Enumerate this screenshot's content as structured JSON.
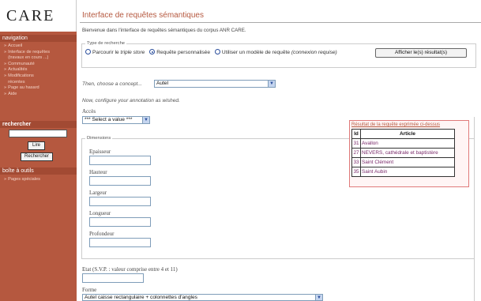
{
  "sidebar": {
    "logo": "CARE",
    "nav_heading": "navigation",
    "nav_items": [
      {
        "label": "Accueil"
      },
      {
        "label": "Interface de requêtes"
      },
      {
        "label": "(travaux en cours ...)"
      },
      {
        "label": "Communauté"
      },
      {
        "label": "Actualités"
      },
      {
        "label": "Modifications"
      },
      {
        "label": "récentes"
      },
      {
        "label": "Page au hasard"
      },
      {
        "label": "Aide"
      }
    ],
    "search_heading": "rechercher",
    "go_button": "Lire",
    "search_button": "Rechercher",
    "toolbox_heading": "boîte à outils",
    "toolbox_items": [
      {
        "label": "Pages spéciales"
      }
    ]
  },
  "main": {
    "title": "Interface de requêtes sémantiques",
    "welcome": "Bienvenue dans l'interface de requêtes sémantiques du corpus ANR CARE.",
    "search_type": {
      "legend": "Type de recherche",
      "opt1_pre": "Parcourir le ",
      "opt1_em": "triple store",
      "opt2": "Requête personnalisée",
      "opt3_pre": "Utiliser un modèle de requête ",
      "opt3_em": "(connexion requise)",
      "selected": "Requête personnalisée",
      "button": "Afficher le(s) résultat(s)"
    },
    "concept_prompt": "Then, choose a concept...",
    "concept_value": "Autel",
    "configure_prompt": "Now, configure your annotation as wished.",
    "acces_label": "Accès",
    "acces_value": "*** Select a value ***",
    "dimensions": {
      "legend": "Dimensions",
      "fields": [
        {
          "label": "Epaisseur"
        },
        {
          "label": "Hauteur"
        },
        {
          "label": "Largeur"
        },
        {
          "label": "Longueur"
        },
        {
          "label": "Profondeur"
        }
      ]
    },
    "etat_label": "Etat (S.V.P. : valeur comprise entre 4 et 11)",
    "forme_label": "Forme",
    "forme_value": "Autel caisse rectangulaire + colonnettes d'angles"
  },
  "results": {
    "title": "Résultat de la requête exprimée ci-dessus",
    "headers": [
      "Id",
      "Article"
    ],
    "rows": [
      {
        "id": "31",
        "article": "Avallon"
      },
      {
        "id": "27",
        "article": "NEVERS, cathédrale et baptistère"
      },
      {
        "id": "33",
        "article": "Saint Clément"
      },
      {
        "id": "35",
        "article": "Saint Aubin"
      }
    ]
  },
  "icons": {
    "bullet": "bullet-icon",
    "dropdown": "chevron-down-icon"
  },
  "colors": {
    "accent": "#b5583f",
    "sidebar": "#b5583f",
    "result_border": "#e07a7a"
  }
}
